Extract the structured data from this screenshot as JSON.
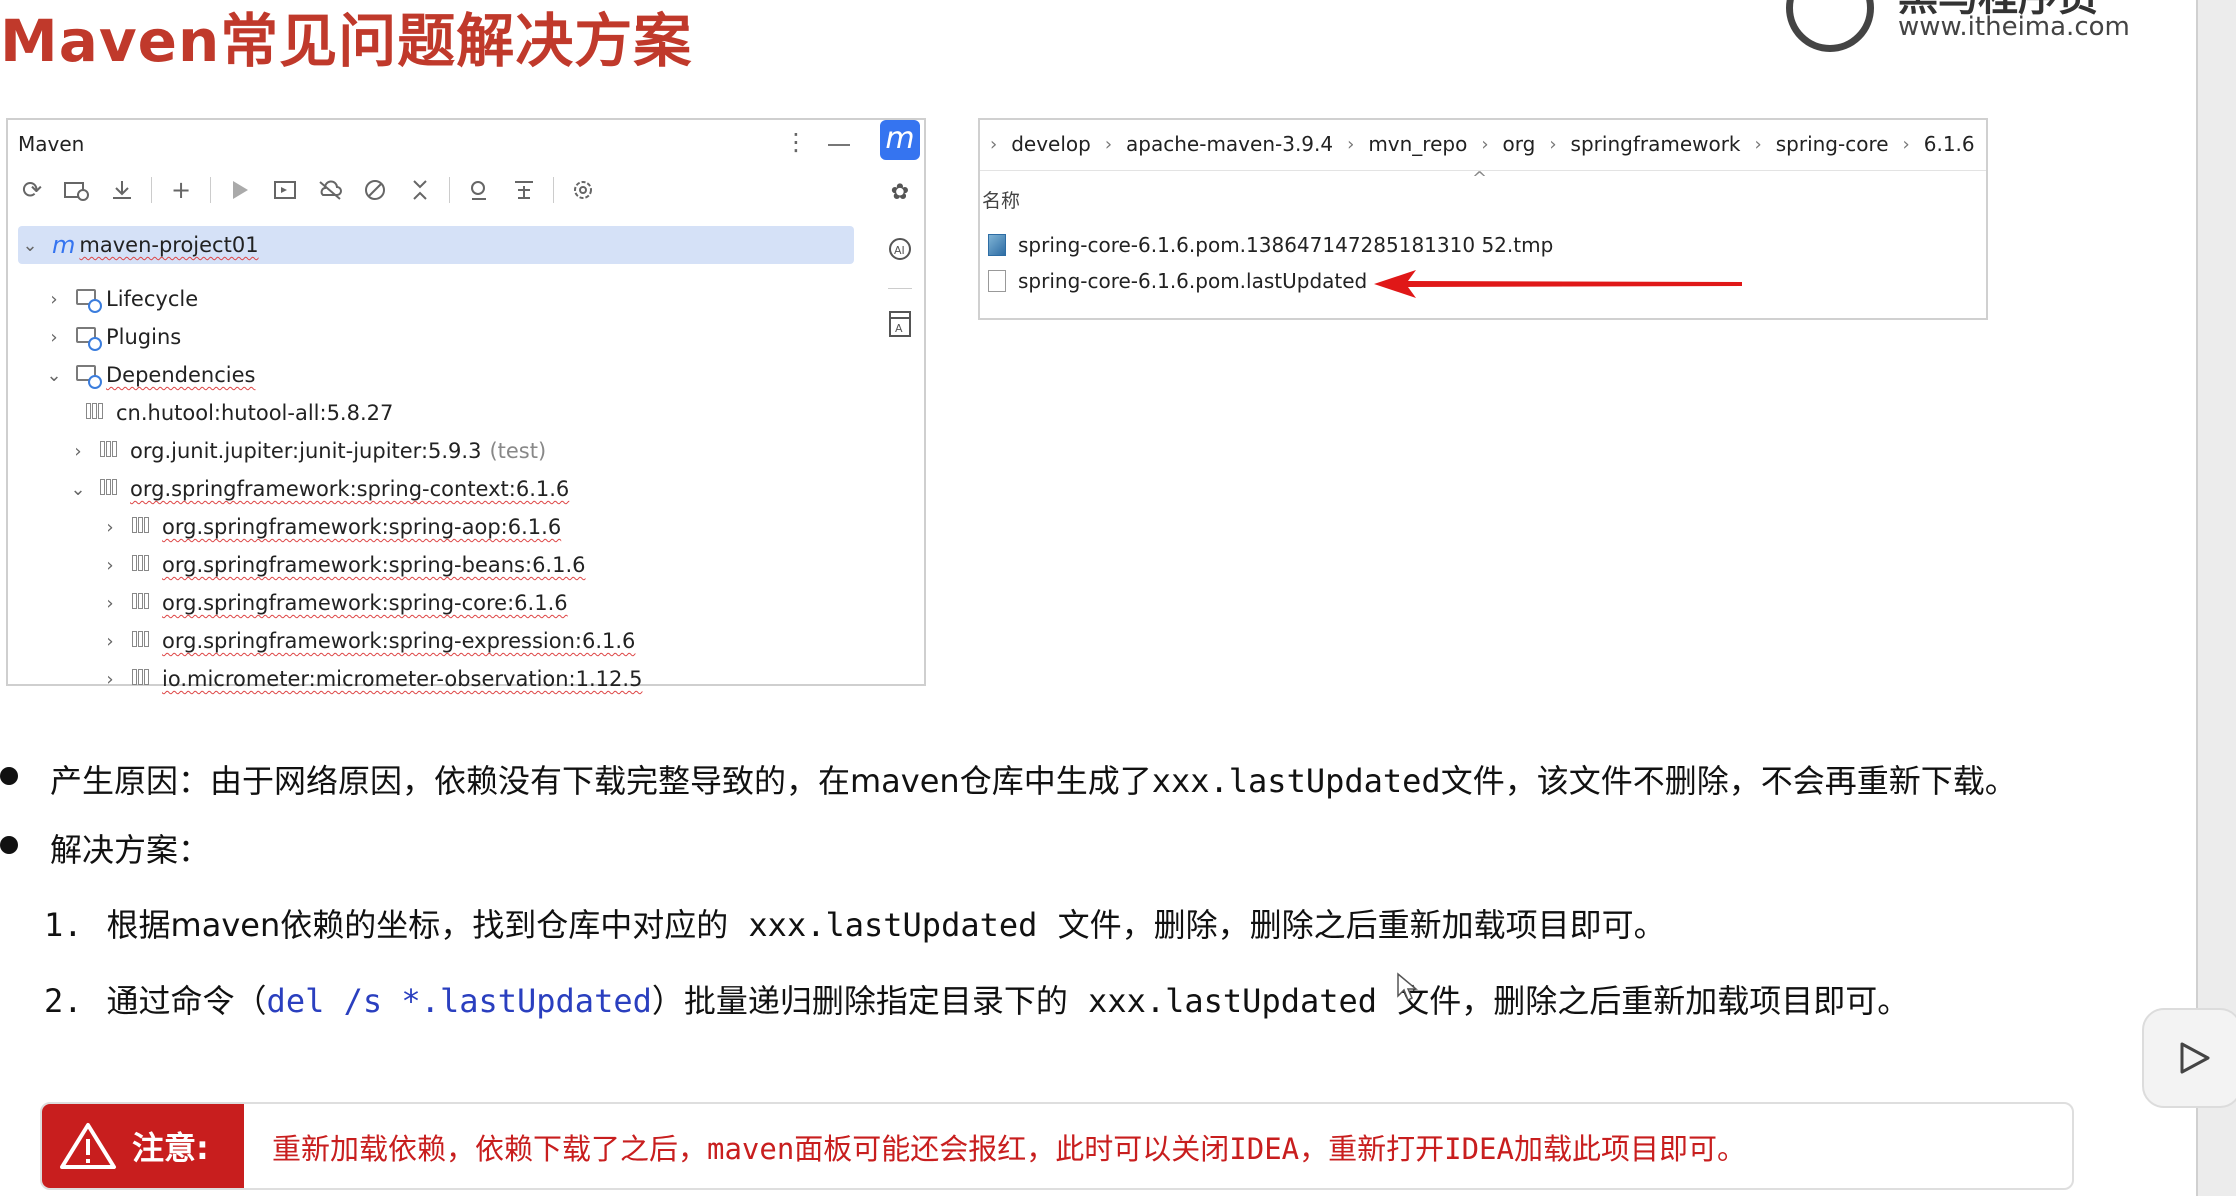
{
  "slide": {
    "title": "Maven常见问题解决方案",
    "logo": {
      "cn": "黑马程序员",
      "url": "www.itheima.com"
    }
  },
  "maven_panel": {
    "header": "Maven",
    "toolbar_icons": [
      "refresh-icon",
      "add-folder-icon",
      "download-icon",
      "plus-icon",
      "run-icon",
      "execute-goal-icon",
      "offline-icon",
      "skip-tests-icon",
      "collapse-icon",
      "analyze-icon",
      "show-deps-icon",
      "settings-icon"
    ],
    "project": "maven-project01",
    "lifecycle": "Lifecycle",
    "plugins": "Plugins",
    "dependencies": "Dependencies",
    "deps": [
      {
        "label": "cn.hutool:hutool-all:5.8.27"
      },
      {
        "label": "org.junit.jupiter:junit-jupiter:5.9.3",
        "scope": "(test)"
      },
      {
        "label": "org.springframework:spring-context:6.1.6"
      }
    ],
    "context_children": [
      "org.springframework:spring-aop:6.1.6",
      "org.springframework:spring-beans:6.1.6",
      "org.springframework:spring-core:6.1.6",
      "org.springframework:spring-expression:6.1.6",
      "io.micrometer:micrometer-observation:1.12.5"
    ]
  },
  "explorer": {
    "breadcrumb": [
      "develop",
      "apache-maven-3.9.4",
      "mvn_repo",
      "org",
      "springframework",
      "spring-core",
      "6.1.6"
    ],
    "column_header": "名称",
    "files": [
      "spring-core-6.1.6.pom.138647147285181310 52.tmp",
      "spring-core-6.1.6.pom.lastUpdated"
    ]
  },
  "content": {
    "bullet1_prefix": "产生原因：由于网络原因，依赖没有下载完整导致的，在maven仓库中生成了",
    "bullet1_code": "xxx.lastUpdated",
    "bullet1_suffix": "文件，该文件不删除，不会再重新下载。",
    "bullet2": "解决方案：",
    "step1_num": "1.",
    "step1_prefix": "根据maven依赖的坐标，找到仓库中对应的",
    "step1_code": "xxx.lastUpdated",
    "step1_suffix": "文件，删除，删除之后重新加载项目即可。",
    "step2_num": "2.",
    "step2_prefix": "通过命令（",
    "step2_cmd": "del /s *.lastUpdated",
    "step2_mid": "）批量递归删除指定目录下的",
    "step2_code": "xxx.lastUpdated",
    "step2_suffix": "文件，删除之后重新加载项目即可。"
  },
  "note": {
    "label": "注意:",
    "text": "重新加载依赖，依赖下载了之后，maven面板可能还会报红，此时可以关闭IDEA，重新打开IDEA加载此项目即可。"
  },
  "colors": {
    "title_red": "#c0392b",
    "note_red": "#c81e1e",
    "maven_blue": "#3574f0",
    "command_blue": "#2a3fbf",
    "selection": "#d5e1f7"
  }
}
